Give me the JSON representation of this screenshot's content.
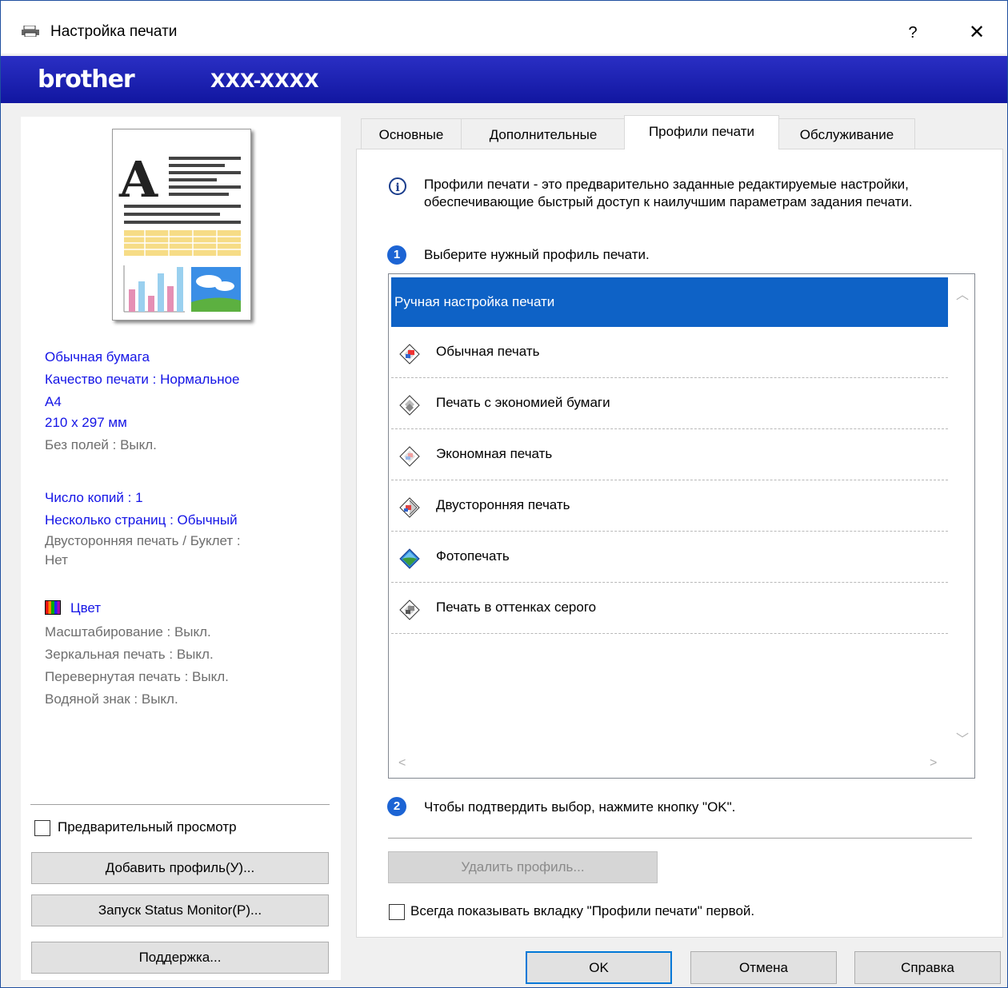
{
  "window": {
    "title": "Настройка печати",
    "help": "?",
    "close": "✕"
  },
  "brand": {
    "logo": "brother",
    "model": "XXX-XXXX"
  },
  "tabs": [
    {
      "label": "Основные"
    },
    {
      "label": "Дополнительные"
    },
    {
      "label": "Профили печати"
    },
    {
      "label": "Обслуживание"
    }
  ],
  "active_tab": "Профили печати",
  "summary": {
    "paper_type": "Обычная бумага",
    "quality": "Качество печати : Нормальное",
    "paper_size": "A4",
    "dimensions": "210 x 297 мм",
    "borderless": "Без полей : Выкл.",
    "copies": "Число копий : 1",
    "multipage": "Несколько страниц : Обычный",
    "duplex_line1": "Двусторонняя печать / Буклет :",
    "duplex_line2": "Нет",
    "color": "Цвет",
    "scaling": "Масштабирование : Выкл.",
    "mirror": "Зеркальная печать : Выкл.",
    "reverse": "Перевернутая печать : Выкл.",
    "watermark": "Водяной знак : Выкл."
  },
  "left_controls": {
    "preview_label": "Предварительный просмотр",
    "preview_checked": false,
    "add_profile": "Добавить профиль(У)...",
    "status_monitor": "Запуск Status Monitor(P)...",
    "support": "Поддержка..."
  },
  "profiles_tab": {
    "info": "Профили печати - это предварительно заданные редактируемые настройки, обеспечивающие быстрый доступ к наилучшим параметрам задания печати.",
    "step1_num": "1",
    "step1": "Выберите нужный профиль печати.",
    "profiles": [
      "Ручная настройка печати",
      "Обычная печать",
      "Печать с экономией бумаги",
      "Экономная печать",
      "Двусторонняя печать",
      "Фотопечать",
      "Печать в оттенках серого"
    ],
    "selected_index": 0,
    "step2_num": "2",
    "step2": "Чтобы подтвердить выбор, нажмите кнопку \"OK\".",
    "delete_profile": "Удалить профиль...",
    "always_show": "Всегда показывать вкладку \"Профили печати\" первой.",
    "always_show_checked": false
  },
  "dialog_buttons": {
    "ok": "OK",
    "cancel": "Отмена",
    "help": "Справка"
  },
  "colors": {
    "brand_bar": "#1b1eb0",
    "selection": "#0e62c6",
    "summary_blue": "#1414e6",
    "summary_gray": "#6e6e6e"
  }
}
